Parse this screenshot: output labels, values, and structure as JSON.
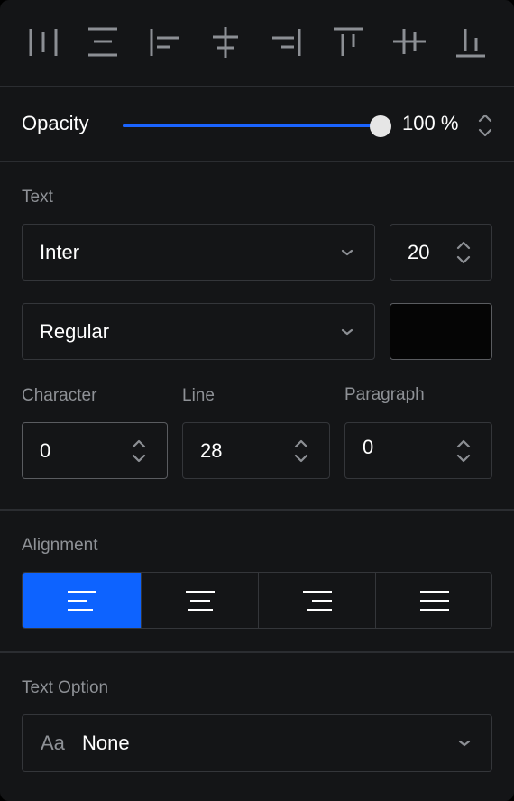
{
  "align_toolbar": {
    "tools": [
      {
        "name": "distribute-horizontal-icon",
        "label": "Distribute horizontally"
      },
      {
        "name": "distribute-vertical-icon",
        "label": "Distribute vertically"
      },
      {
        "name": "align-left-icon",
        "label": "Align left"
      },
      {
        "name": "align-horizontal-center-icon",
        "label": "Align horizontal centers"
      },
      {
        "name": "align-right-icon",
        "label": "Align right"
      },
      {
        "name": "align-top-icon",
        "label": "Align top"
      },
      {
        "name": "align-vertical-center-icon",
        "label": "Align vertical centers"
      },
      {
        "name": "align-bottom-icon",
        "label": "Align bottom"
      }
    ]
  },
  "opacity": {
    "label": "Opacity",
    "value_text": "100 %",
    "level_percent": 100,
    "accent_color": "#1a64ff"
  },
  "text": {
    "section_title": "Text",
    "font_family": "Inter",
    "font_size": "20",
    "font_weight": "Regular",
    "color": "#050505",
    "character_label": "Character",
    "character_value": "0",
    "line_label": "Line",
    "line_value": "28",
    "paragraph_label": "Paragraph",
    "paragraph_value": "0"
  },
  "alignment": {
    "section_title": "Alignment",
    "selected": "left",
    "options": [
      "left",
      "center",
      "right",
      "justify"
    ],
    "active_color": "#0d63ff"
  },
  "text_option": {
    "section_title": "Text Option",
    "icon_text": "Aa",
    "value": "None"
  }
}
